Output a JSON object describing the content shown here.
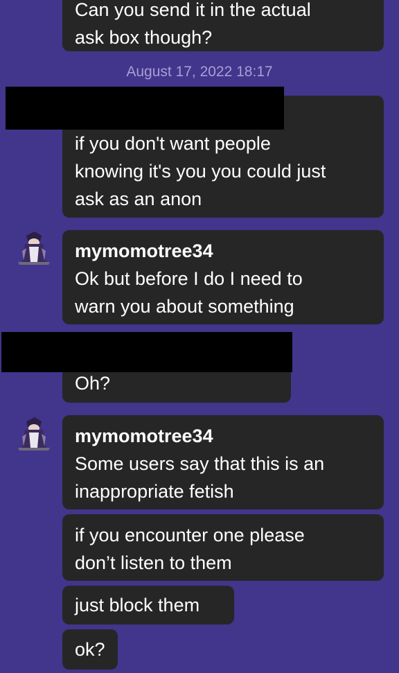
{
  "messages": [
    {
      "id": "m0",
      "lines": [
        "Can you send it in the actual",
        "ask box though?"
      ]
    },
    {
      "id": "m1",
      "lines": [
        "if you don't want people",
        "knowing it's you you could just",
        "ask as an anon"
      ]
    },
    {
      "id": "m2",
      "sender": "mymomotree34",
      "lines": [
        "Ok but before I do I need to",
        "warn you about something"
      ]
    },
    {
      "id": "m3",
      "lines": [
        "Oh?"
      ]
    },
    {
      "id": "m4",
      "sender": "mymomotree34",
      "lines": [
        "Some users say that this is an",
        "inappropriate fetish"
      ]
    },
    {
      "id": "m5",
      "lines": [
        "if you encounter one please",
        "don’t listen to them"
      ]
    },
    {
      "id": "m6",
      "lines": [
        "just block them"
      ]
    },
    {
      "id": "m7",
      "lines": [
        "ok?"
      ]
    }
  ],
  "timestamp": "August 17, 2022 18:17",
  "colors": {
    "background": "#42358c",
    "bubble": "#262626",
    "timestamp": "#a99ed4",
    "redaction": "#000000"
  },
  "avatar_icon": "character-avatar-icon"
}
